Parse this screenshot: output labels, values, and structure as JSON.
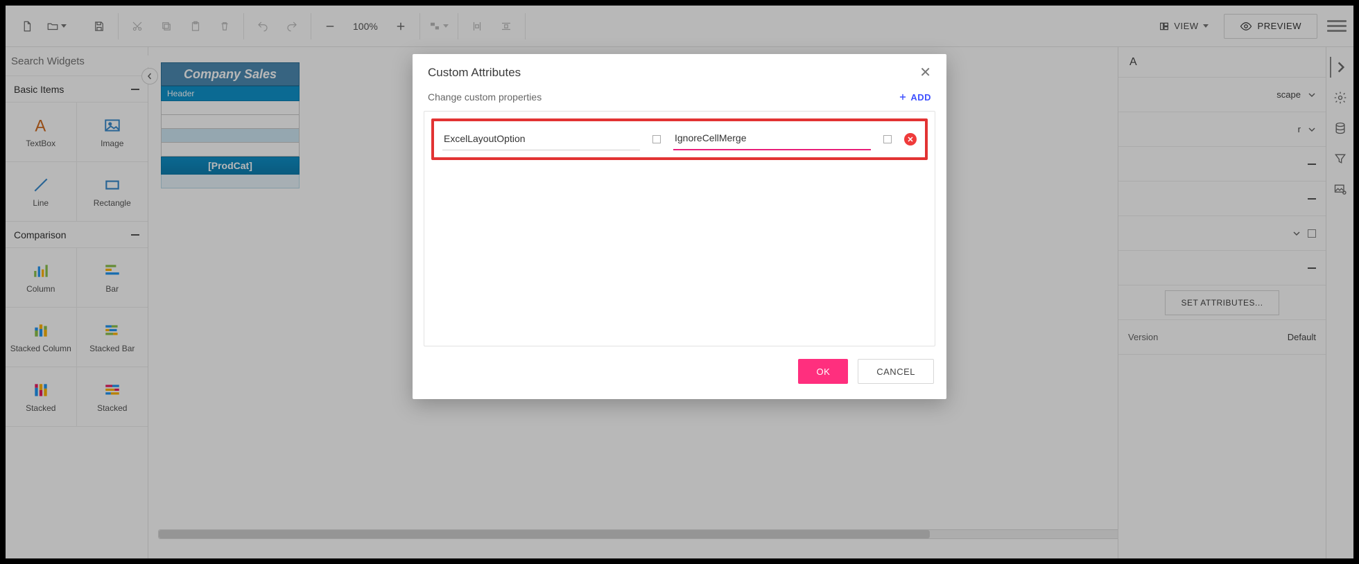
{
  "toolbar": {
    "zoom": "100%",
    "view_label": "VIEW",
    "preview_label": "PREVIEW"
  },
  "left_panel": {
    "search_placeholder": "Search Widgets",
    "categories": [
      {
        "title": "Basic Items",
        "items": [
          "TextBox",
          "Image",
          "Line",
          "Rectangle"
        ]
      },
      {
        "title": "Comparison",
        "items": [
          "Column",
          "Bar",
          "Stacked Column",
          "Stacked Bar",
          "Stacked",
          "Stacked"
        ]
      }
    ]
  },
  "canvas": {
    "report_title": "Company Sales",
    "header_label": "Header",
    "prodcat_label": "[ProdCat]"
  },
  "right_panel": {
    "title_fragment": "A",
    "orientation": "scape",
    "paper": "r",
    "set_attributes_label": "SET ATTRIBUTES...",
    "version_label": "Version",
    "version_value": "Default"
  },
  "modal": {
    "title": "Custom Attributes",
    "subtitle": "Change custom properties",
    "add_label": "ADD",
    "row": {
      "key": "ExcelLayoutOption",
      "value": "IgnoreCellMerge"
    },
    "ok_label": "OK",
    "cancel_label": "CANCEL"
  }
}
